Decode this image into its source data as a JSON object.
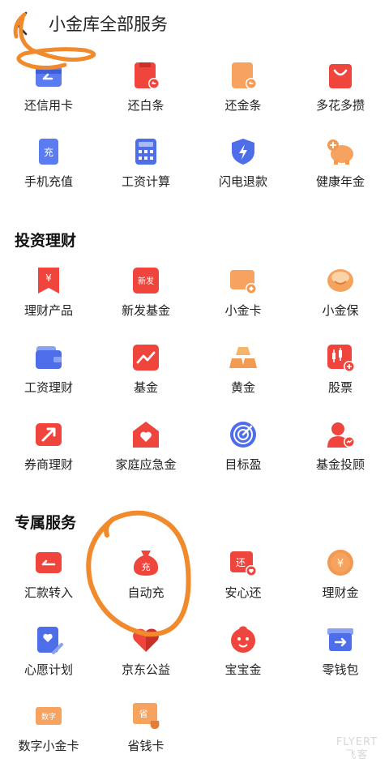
{
  "header": {
    "title": "小金库全部服务"
  },
  "top_services": [
    {
      "label": "还信用卡",
      "icon": "repay-credit-card-icon"
    },
    {
      "label": "还白条",
      "icon": "repay-baitiao-icon"
    },
    {
      "label": "还金条",
      "icon": "repay-jintiao-icon"
    },
    {
      "label": "多花多攒",
      "icon": "shopping-bag-icon"
    },
    {
      "label": "手机充值",
      "icon": "phone-recharge-icon"
    },
    {
      "label": "工资计算",
      "icon": "calculator-icon"
    },
    {
      "label": "闪电退款",
      "icon": "lightning-shield-icon"
    },
    {
      "label": "健康年金",
      "icon": "piggy-bank-icon"
    }
  ],
  "invest": {
    "title": "投资理财",
    "items": [
      {
        "label": "理财产品",
        "icon": "yuan-bookmark-icon"
      },
      {
        "label": "新发基金",
        "icon": "new-fund-icon"
      },
      {
        "label": "小金卡",
        "icon": "gold-card-icon"
      },
      {
        "label": "小金保",
        "icon": "gold-bowl-icon"
      },
      {
        "label": "工资理财",
        "icon": "wallet-icon"
      },
      {
        "label": "基金",
        "icon": "trend-chart-icon"
      },
      {
        "label": "黄金",
        "icon": "gold-bars-icon"
      },
      {
        "label": "股票",
        "icon": "candlestick-icon"
      },
      {
        "label": "券商理财",
        "icon": "arrow-up-right-icon"
      },
      {
        "label": "家庭应急金",
        "icon": "heart-house-icon"
      },
      {
        "label": "目标盈",
        "icon": "target-icon"
      },
      {
        "label": "基金投顾",
        "icon": "advisor-icon"
      }
    ]
  },
  "exclusive": {
    "title": "专属服务",
    "items": [
      {
        "label": "汇款转入",
        "icon": "transfer-in-icon"
      },
      {
        "label": "自动充",
        "icon": "money-bag-icon"
      },
      {
        "label": "安心还",
        "icon": "repay-heart-icon"
      },
      {
        "label": "理财金",
        "icon": "yuan-coin-icon"
      },
      {
        "label": "心愿计划",
        "icon": "wish-plan-icon"
      },
      {
        "label": "京东公益",
        "icon": "charity-heart-icon"
      },
      {
        "label": "宝宝金",
        "icon": "baby-face-icon"
      },
      {
        "label": "零钱包",
        "icon": "change-box-icon"
      },
      {
        "label": "数字小金卡",
        "icon": "digital-card-icon"
      },
      {
        "label": "省钱卡",
        "icon": "saving-card-icon"
      }
    ]
  },
  "watermark": {
    "line1": "FLYERT",
    "line2": "飞客"
  },
  "colors": {
    "red": "#f0453c",
    "orange": "#f29a52",
    "blue": "#4d6ee8",
    "annotation": "#f08a2c"
  }
}
